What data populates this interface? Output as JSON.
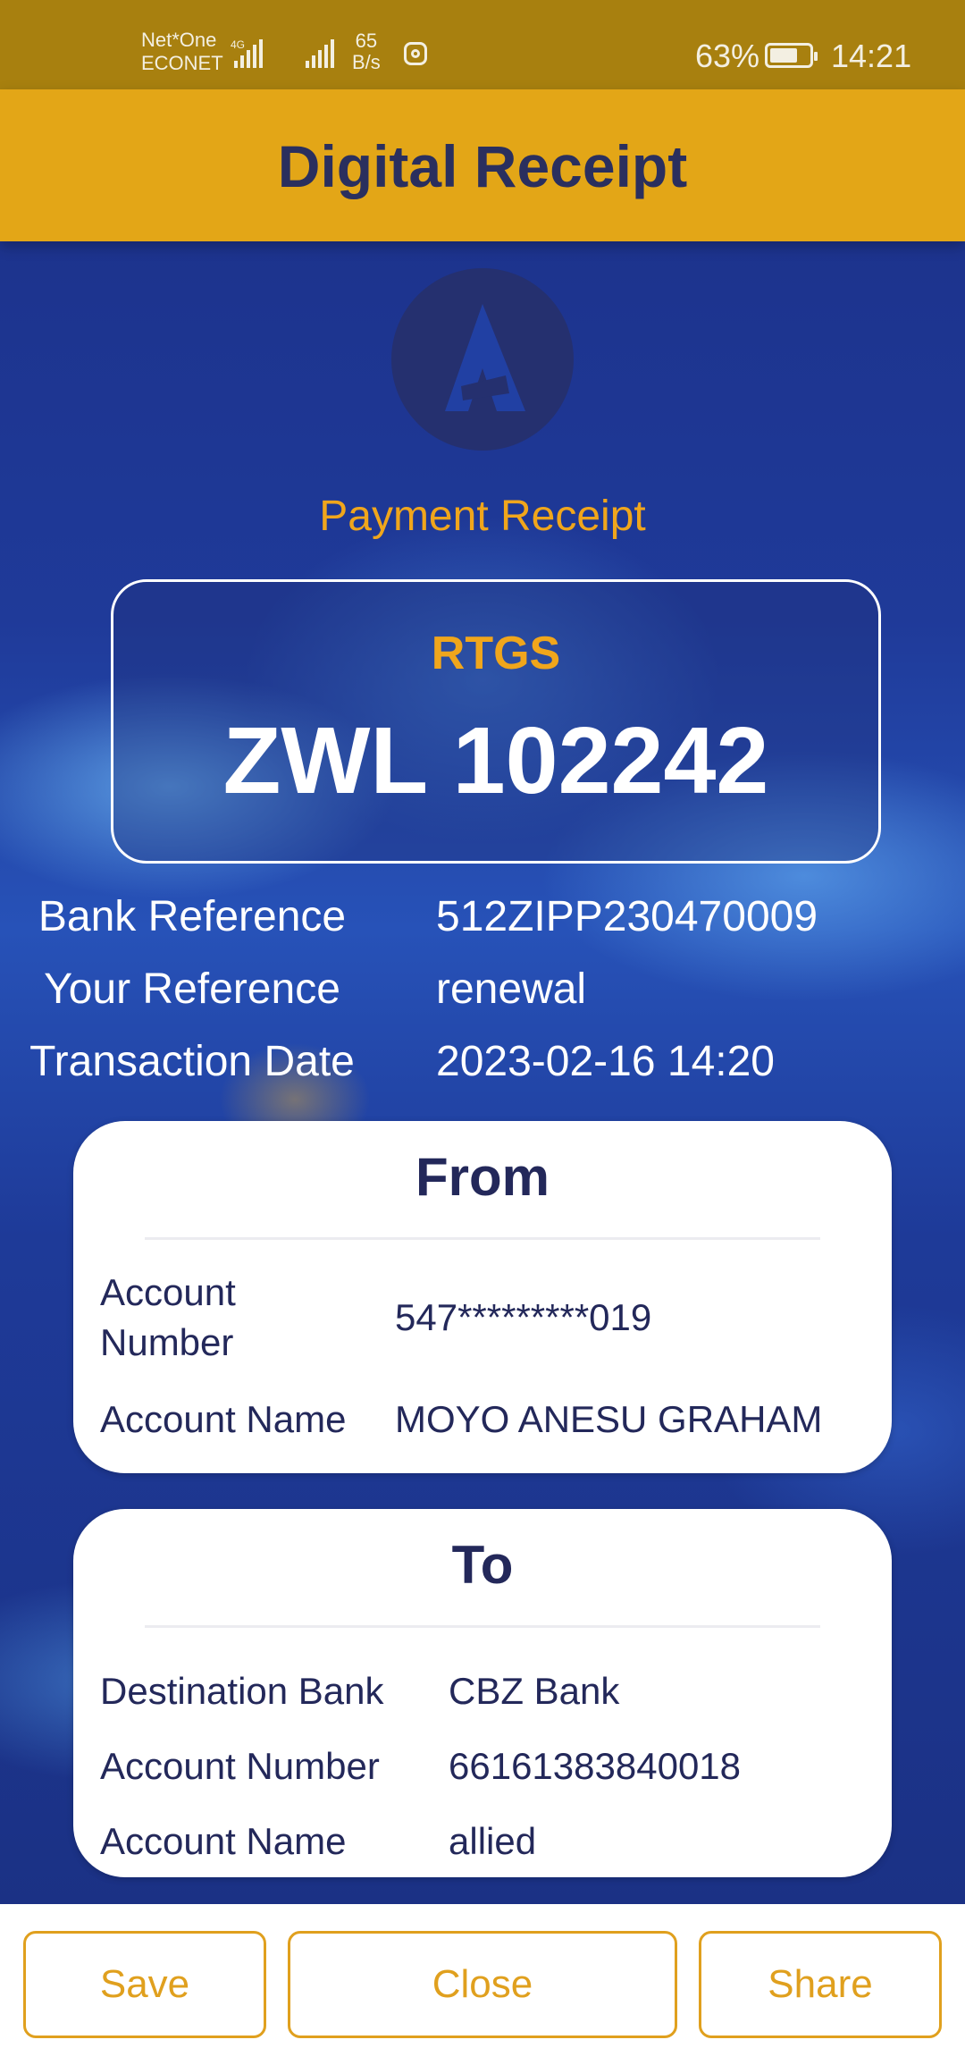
{
  "status_bar": {
    "carrier_line1": "Net*One",
    "carrier_line2": "ECONET",
    "network_type": "4G",
    "speed_value": "65",
    "speed_unit": "B/s",
    "battery": "63%",
    "time": "14:21",
    "icons": [
      "signal-icon",
      "signal-icon",
      "instagram-icon",
      "battery-icon"
    ]
  },
  "header": {
    "title": "Digital Receipt"
  },
  "receipt": {
    "heading": "Payment Receipt",
    "type": "RTGS",
    "amount": "ZWL 102242"
  },
  "references": [
    {
      "label": "Bank Reference",
      "value": "512ZIPP230470009"
    },
    {
      "label": "Your Reference",
      "value": "renewal"
    },
    {
      "label": "Transaction Date",
      "value": "2023-02-16 14:20"
    }
  ],
  "from_card": {
    "title": "From",
    "rows": [
      {
        "label": "Account Number",
        "value": "547*********019"
      },
      {
        "label": "Account Name",
        "value": "MOYO ANESU GRAHAM"
      }
    ]
  },
  "to_card": {
    "title": "To",
    "rows": [
      {
        "label": "Destination Bank",
        "value": "CBZ Bank"
      },
      {
        "label": "Account Number",
        "value": "66161383840018"
      },
      {
        "label": "Account Name",
        "value": "allied"
      }
    ]
  },
  "actions": {
    "save": "Save",
    "close": "Close",
    "share": "Share"
  },
  "colors": {
    "accent": "#e3a617",
    "status_bar": "#a8800f",
    "text_dark": "#23285a",
    "orange_text": "#f0a61c"
  }
}
